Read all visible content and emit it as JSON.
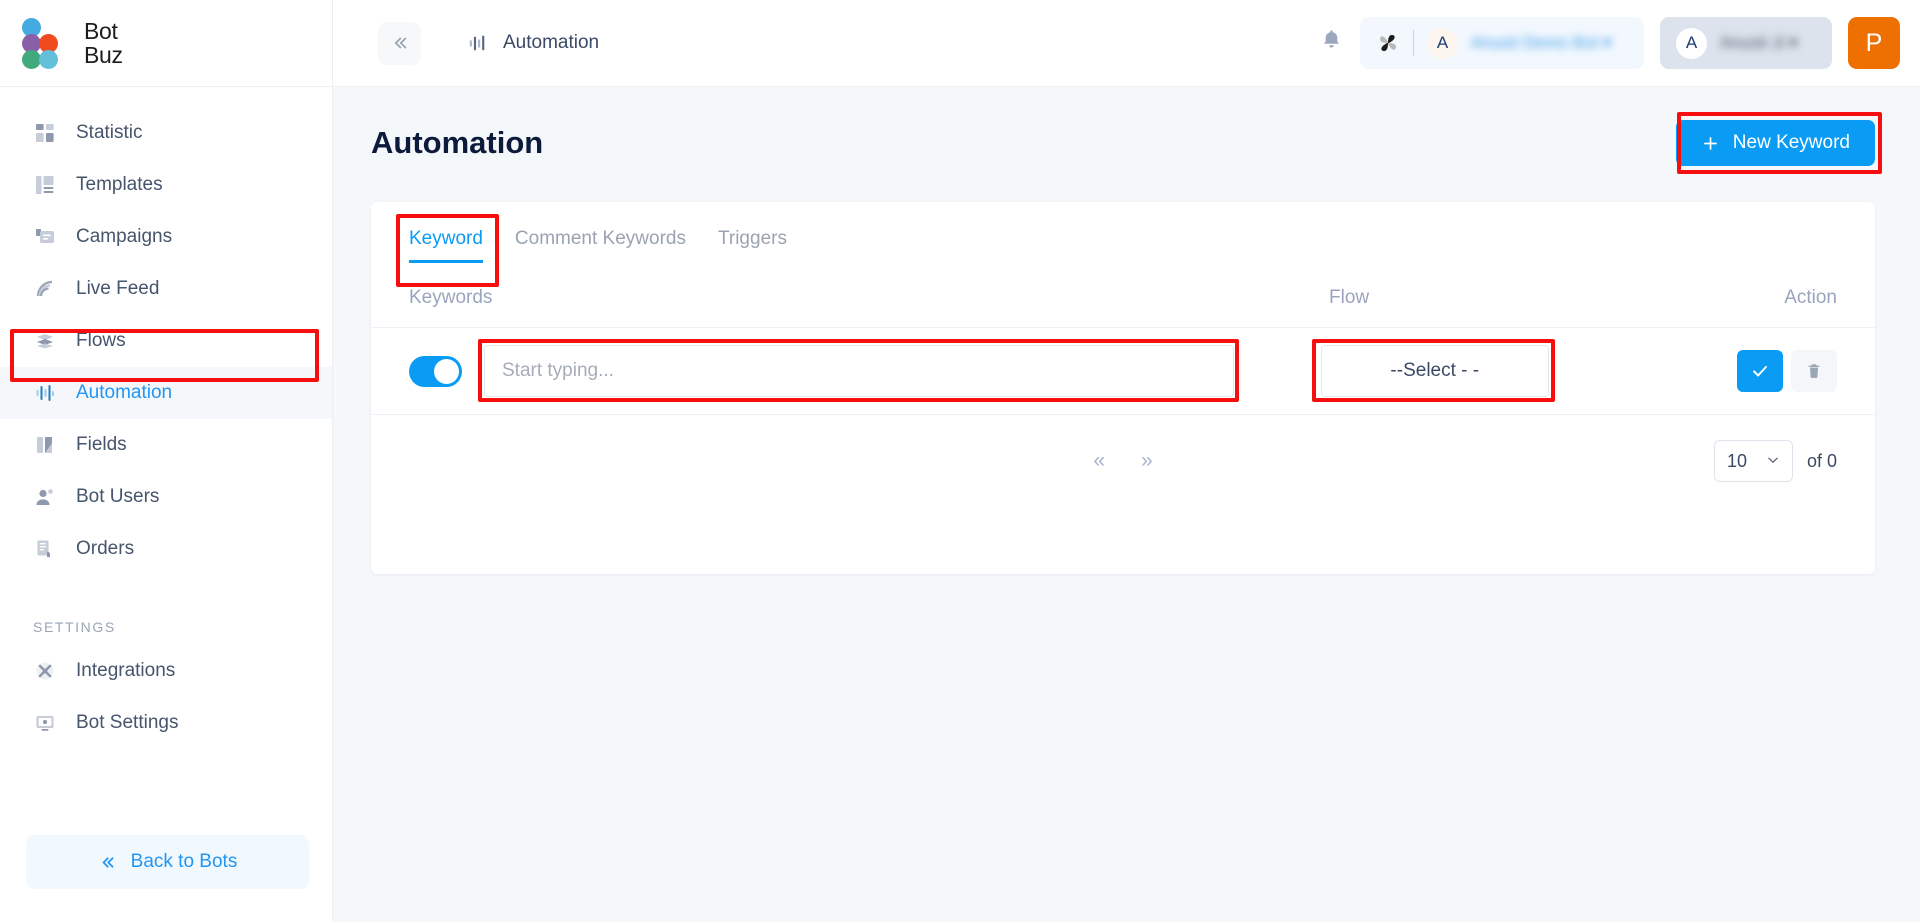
{
  "brand": {
    "line1": "Bot",
    "line2": "Buz"
  },
  "topbar": {
    "collapse_icon": "double-chevron-left",
    "breadcrumb_icon": "automation-bars-icon",
    "breadcrumb_label": "Automation",
    "notification_icon": "bell-icon",
    "bot_pill": {
      "icon": "pinwheel-icon",
      "avatar_letter": "A",
      "name_blurred": "Anusti Demo Bot ▾"
    },
    "user_pill": {
      "avatar_letter": "A",
      "name_blurred": "Anusti Ji ▾"
    },
    "profile_badge": "P"
  },
  "sidebar": {
    "items": [
      {
        "label": "Statistic",
        "icon": "grid-squares-icon",
        "active": false
      },
      {
        "label": "Templates",
        "icon": "template-icon",
        "active": false
      },
      {
        "label": "Campaigns",
        "icon": "megaphone-chat-icon",
        "active": false
      },
      {
        "label": "Live Feed",
        "icon": "rss-feed-icon",
        "active": false
      },
      {
        "label": "Flows",
        "icon": "flows-layers-icon",
        "active": false
      },
      {
        "label": "Automation",
        "icon": "automation-bars-icon",
        "active": true
      },
      {
        "label": "Fields",
        "icon": "fields-book-icon",
        "active": false
      },
      {
        "label": "Bot Users",
        "icon": "users-icon",
        "active": false
      },
      {
        "label": "Orders",
        "icon": "orders-receipt-icon",
        "active": false
      }
    ],
    "section_label": "SETTINGS",
    "settings_items": [
      {
        "label": "Integrations",
        "icon": "puzzle-integration-icon"
      },
      {
        "label": "Bot Settings",
        "icon": "monitor-settings-icon"
      }
    ],
    "back_button": {
      "label": "Back to Bots",
      "icon": "double-chevron-left"
    }
  },
  "main": {
    "page_title": "Automation",
    "new_button": {
      "label": "New Keyword",
      "icon": "plus-icon"
    },
    "tabs": [
      {
        "label": "Keyword",
        "active": true
      },
      {
        "label": "Comment Keywords",
        "active": false
      },
      {
        "label": "Triggers",
        "active": false
      }
    ],
    "table": {
      "headers": {
        "keywords": "Keywords",
        "flow": "Flow",
        "action": "Action"
      },
      "row": {
        "toggle_on": true,
        "keyword_value": "",
        "keyword_placeholder": "Start typing...",
        "flow_value": "--Select - -",
        "confirm_icon": "check-icon",
        "delete_icon": "trash-icon"
      }
    },
    "footer": {
      "prev_icon": "«",
      "next_icon": "»",
      "page_size": "10",
      "page_size_chevron": "chevron-down-icon",
      "of_label": "of 0"
    }
  },
  "colors": {
    "accent": "#0a9cf5",
    "highlight": "#f50f0f",
    "orange": "#ed7000",
    "page_bg": "#f5f8fb"
  }
}
